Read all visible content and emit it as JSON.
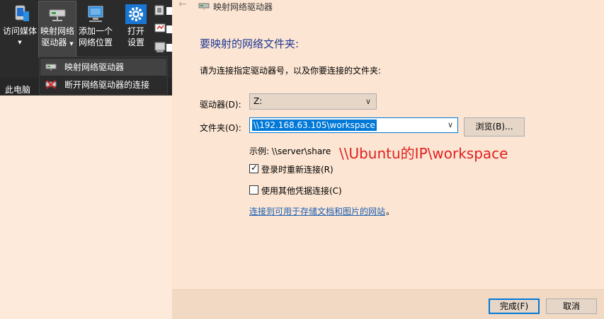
{
  "ribbon": {
    "access_media": "访问媒体",
    "map_drive_line1": "映射网络",
    "map_drive_line2": "驱动器",
    "add_location_line1": "添加一个",
    "add_location_line2": "网络位置",
    "open_settings_line1": "打开",
    "open_settings_line2": "设置",
    "this_pc": "此电脑"
  },
  "menu": {
    "items": [
      {
        "label": "映射网络驱动器"
      },
      {
        "label": "断开网络驱动器的连接"
      }
    ]
  },
  "dialog": {
    "title": "映射网络驱动器",
    "heading": "要映射的网络文件夹:",
    "subtext": "请为连接指定驱动器号，以及你要连接的文件夹:",
    "drive_label": "驱动器(D):",
    "drive_value": "Z:",
    "folder_label": "文件夹(O):",
    "folder_value": "\\\\192.168.63.105\\workspace",
    "browse_label": "浏览(B)...",
    "example_text": "示例: \\\\server\\share",
    "annotation": "\\\\Ubuntu的IP\\workspace",
    "reconnect_label": "登录时重新连接(R)",
    "reconnect_checked": true,
    "other_cred_label": "使用其他凭据连接(C)",
    "other_cred_checked": false,
    "store_link": "连接到可用于存储文档和图片的网站",
    "store_link_suffix": "。",
    "finish_label": "完成(F)",
    "cancel_label": "取消"
  },
  "colors": {
    "ribbon_bg": "#2b2b2b",
    "dialog_bg": "#fce5d2",
    "heading": "#1f3a93",
    "selection": "#0078d7",
    "annotation": "#e02020",
    "link": "#1a5fb4"
  }
}
